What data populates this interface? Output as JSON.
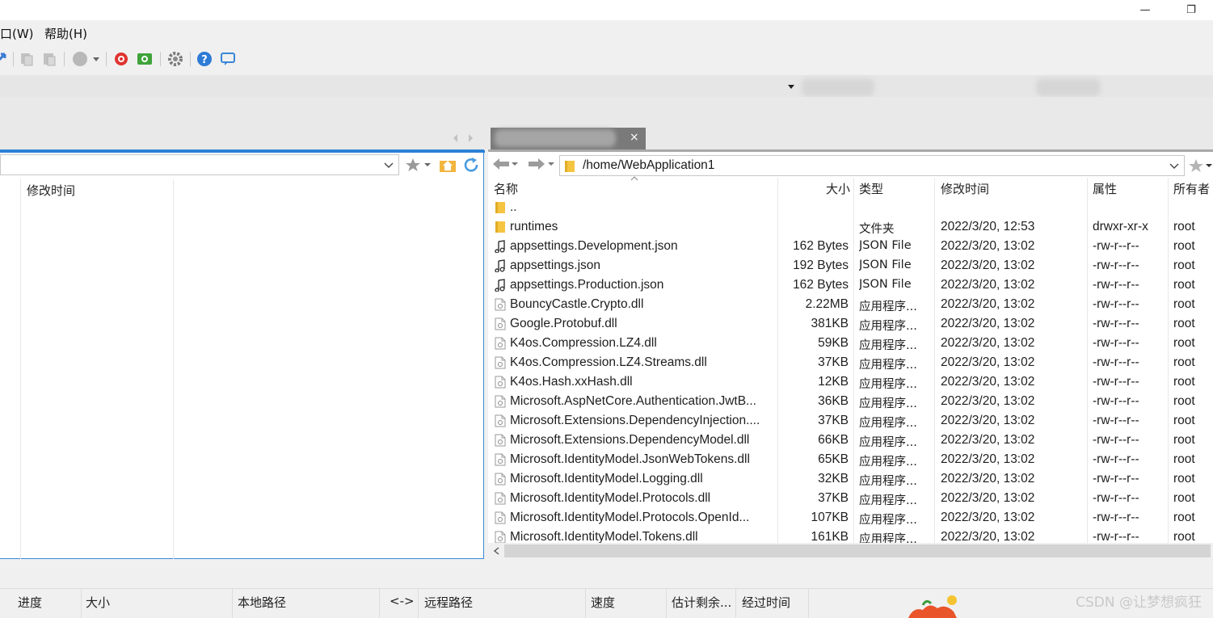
{
  "window": {
    "minimize_glyph": "—",
    "restore_glyph": "❐"
  },
  "menu": {
    "items": [
      "口(W)",
      "帮助(H)"
    ]
  },
  "toolbar": {
    "icons": [
      "sync-arrow-icon",
      "copy-icon",
      "paste-icon",
      "record-icon",
      "dropdown-icon",
      "bookmark-red-icon",
      "green-transfer-icon",
      "gear-icon",
      "help-icon",
      "chat-icon"
    ]
  },
  "left_pane": {
    "columns": [
      "修改时间"
    ],
    "path": ""
  },
  "right_pane": {
    "tab_close_glyph": "×",
    "path": "/home/WebApplication1",
    "columns": {
      "name": "名称",
      "size": "大小",
      "type": "类型",
      "modified": "修改时间",
      "attributes": "属性",
      "owner": "所有者"
    },
    "files": [
      {
        "icon": "folder-icon",
        "name": "..",
        "size": "",
        "type": "",
        "modified": "",
        "attributes": "",
        "owner": ""
      },
      {
        "icon": "folder-icon",
        "name": "runtimes",
        "size": "",
        "type": "文件夹",
        "modified": "2022/3/20, 12:53",
        "attributes": "drwxr-xr-x",
        "owner": "root"
      },
      {
        "icon": "json-file-icon",
        "name": "appsettings.Development.json",
        "size": "162 Bytes",
        "type": "JSON File",
        "modified": "2022/3/20, 13:02",
        "attributes": "-rw-r--r--",
        "owner": "root"
      },
      {
        "icon": "json-file-icon",
        "name": "appsettings.json",
        "size": "192 Bytes",
        "type": "JSON File",
        "modified": "2022/3/20, 13:02",
        "attributes": "-rw-r--r--",
        "owner": "root"
      },
      {
        "icon": "json-file-icon",
        "name": "appsettings.Production.json",
        "size": "162 Bytes",
        "type": "JSON File",
        "modified": "2022/3/20, 13:02",
        "attributes": "-rw-r--r--",
        "owner": "root"
      },
      {
        "icon": "dll-file-icon",
        "name": "BouncyCastle.Crypto.dll",
        "size": "2.22MB",
        "type": "应用程序...",
        "modified": "2022/3/20, 13:02",
        "attributes": "-rw-r--r--",
        "owner": "root"
      },
      {
        "icon": "dll-file-icon",
        "name": "Google.Protobuf.dll",
        "size": "381KB",
        "type": "应用程序...",
        "modified": "2022/3/20, 13:02",
        "attributes": "-rw-r--r--",
        "owner": "root"
      },
      {
        "icon": "dll-file-icon",
        "name": "K4os.Compression.LZ4.dll",
        "size": "59KB",
        "type": "应用程序...",
        "modified": "2022/3/20, 13:02",
        "attributes": "-rw-r--r--",
        "owner": "root"
      },
      {
        "icon": "dll-file-icon",
        "name": "K4os.Compression.LZ4.Streams.dll",
        "size": "37KB",
        "type": "应用程序...",
        "modified": "2022/3/20, 13:02",
        "attributes": "-rw-r--r--",
        "owner": "root"
      },
      {
        "icon": "dll-file-icon",
        "name": "K4os.Hash.xxHash.dll",
        "size": "12KB",
        "type": "应用程序...",
        "modified": "2022/3/20, 13:02",
        "attributes": "-rw-r--r--",
        "owner": "root"
      },
      {
        "icon": "dll-file-icon",
        "name": "Microsoft.AspNetCore.Authentication.JwtB...",
        "size": "36KB",
        "type": "应用程序...",
        "modified": "2022/3/20, 13:02",
        "attributes": "-rw-r--r--",
        "owner": "root"
      },
      {
        "icon": "dll-file-icon",
        "name": "Microsoft.Extensions.DependencyInjection....",
        "size": "37KB",
        "type": "应用程序...",
        "modified": "2022/3/20, 13:02",
        "attributes": "-rw-r--r--",
        "owner": "root"
      },
      {
        "icon": "dll-file-icon",
        "name": "Microsoft.Extensions.DependencyModel.dll",
        "size": "66KB",
        "type": "应用程序...",
        "modified": "2022/3/20, 13:02",
        "attributes": "-rw-r--r--",
        "owner": "root"
      },
      {
        "icon": "dll-file-icon",
        "name": "Microsoft.IdentityModel.JsonWebTokens.dll",
        "size": "65KB",
        "type": "应用程序...",
        "modified": "2022/3/20, 13:02",
        "attributes": "-rw-r--r--",
        "owner": "root"
      },
      {
        "icon": "dll-file-icon",
        "name": "Microsoft.IdentityModel.Logging.dll",
        "size": "32KB",
        "type": "应用程序...",
        "modified": "2022/3/20, 13:02",
        "attributes": "-rw-r--r--",
        "owner": "root"
      },
      {
        "icon": "dll-file-icon",
        "name": "Microsoft.IdentityModel.Protocols.dll",
        "size": "37KB",
        "type": "应用程序...",
        "modified": "2022/3/20, 13:02",
        "attributes": "-rw-r--r--",
        "owner": "root"
      },
      {
        "icon": "dll-file-icon",
        "name": "Microsoft.IdentityModel.Protocols.OpenId...",
        "size": "107KB",
        "type": "应用程序...",
        "modified": "2022/3/20, 13:02",
        "attributes": "-rw-r--r--",
        "owner": "root"
      },
      {
        "icon": "dll-file-icon",
        "name": "Microsoft.IdentityModel.Tokens.dll",
        "size": "161KB",
        "type": "应用程序...",
        "modified": "2022/3/20, 13:02",
        "attributes": "-rw-r--r--",
        "owner": "root"
      }
    ]
  },
  "transfer_queue": {
    "columns": [
      "进度",
      "大小",
      "本地路径",
      "<->",
      "远程路径",
      "速度",
      "估计剩余...",
      "经过时间"
    ]
  },
  "watermark": "CSDN @让梦想疯狂",
  "colors": {
    "accent": "#2b7fd6",
    "folder": "#f5c542"
  }
}
